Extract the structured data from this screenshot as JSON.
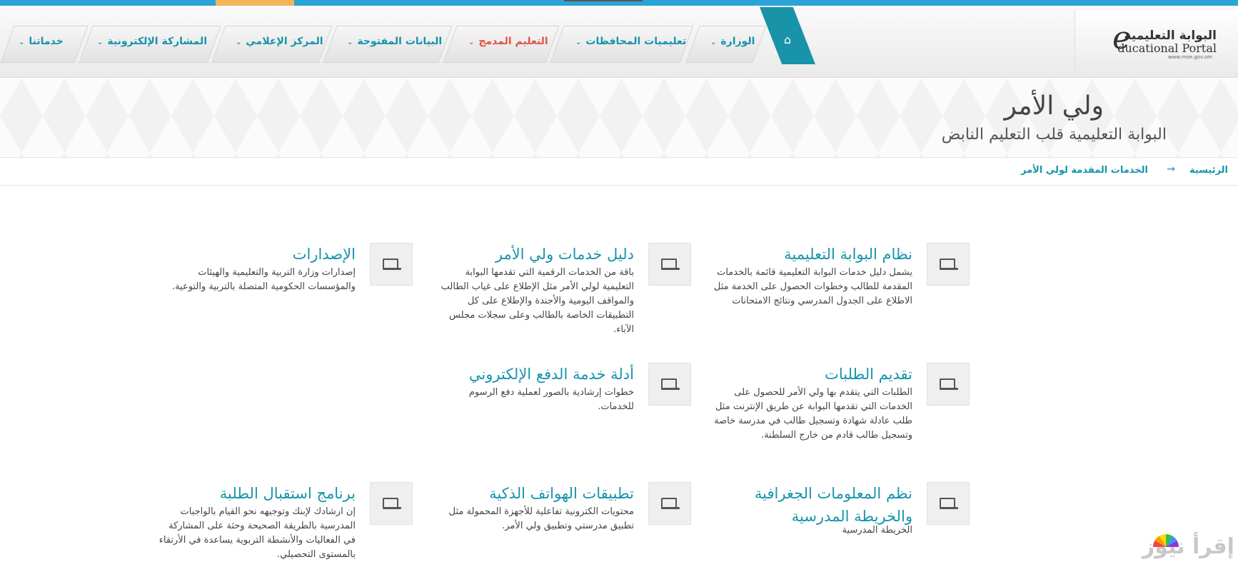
{
  "logo": {
    "arabic": "البوابة التعليمية",
    "english": "ducational Portal",
    "letter": "e",
    "url": "www.moe.gov.om"
  },
  "nav": {
    "items": [
      {
        "label": "الوزارة"
      },
      {
        "label": "تعليميات المحافظات"
      },
      {
        "label": "التعليم المدمج"
      },
      {
        "label": "البيانات المفتوحة"
      },
      {
        "label": "المركز الإعلامي"
      },
      {
        "label": "المشاركة الإلكترونية"
      },
      {
        "label": "خدماتنا"
      }
    ],
    "active_color": "#e0554c",
    "accent": "#1794ab"
  },
  "hero": {
    "title": "ولي الأمر",
    "subtitle": "البوابة التعليمية قلب التعليم النابض"
  },
  "breadcrumb": {
    "home": "الرئيسية",
    "arrow": "→",
    "current": "الخدمات المقدمة لولي الأمر"
  },
  "services": [
    {
      "title": "نظام البوابة التعليمية",
      "desc": "يشمل دليل خدمات البوابة التعليمية قائمة بالخدمات المقدمة للطالب وخطوات الحصول على الخدمة مثل الاطلاع على الجدول المدرسي ونتائج الامتحانات"
    },
    {
      "title": "دليل خدمات ولي الأمر",
      "desc": "باقة من الخدمات الرقمية التي تقدمها البوابة التعليمية لولي الأمر مثل الإطلاع على غياب الطالب والمواقف اليومية والأجندة والإطلاع على كل التطبيقات الخاصة بالطالب وعلى سجلات مجلس الآباء."
    },
    {
      "title": "الإصدارات",
      "desc": "إصدارات وزارة التربية والتعليمية والهيئات والمؤسسات الحكومية المتصلة بالتربية والتوعية."
    },
    {
      "title": "تقديم الطلبات",
      "desc": "الطلبات التي يتقدم بها ولي الأمر للحصول على الخدمات التي تقدمها البوابة عن طريق الإنترنت مثل طلب عادلة شهادة وتسجيل طالب في مدرسة خاصة وتسجيل طالب قادم من خارج السلطنة."
    },
    {
      "title": "أدلة خدمة الدفع الإلكتروني",
      "desc": "خطوات إرشادية بالصور لعملية دفع الرسوم للخدمات."
    },
    {
      "title": "نظم المعلومات الجغرافية والخريطة المدرسية",
      "desc": "الخريطة المدرسية"
    },
    {
      "title": "تطبيقات الهواتف الذكية",
      "desc": "محتويات الكترونية تفاعلية للأجهزة المحمولة مثل تطبيق مدرستي وتطبيق ولي الأمر."
    },
    {
      "title": "برنامج استقبال الطلبة",
      "desc": "إن ارشادك لإبنك وتوجيهه نحو القيام بالواجبات المدرسية بالطريقة الصحيحة وحثة على المشاركة في الفعاليات والأنشطة التربوية يساعدة في الأرتقاء بالمستوى التحصيلي."
    }
  ],
  "watermark": "إقرأ نيوز"
}
